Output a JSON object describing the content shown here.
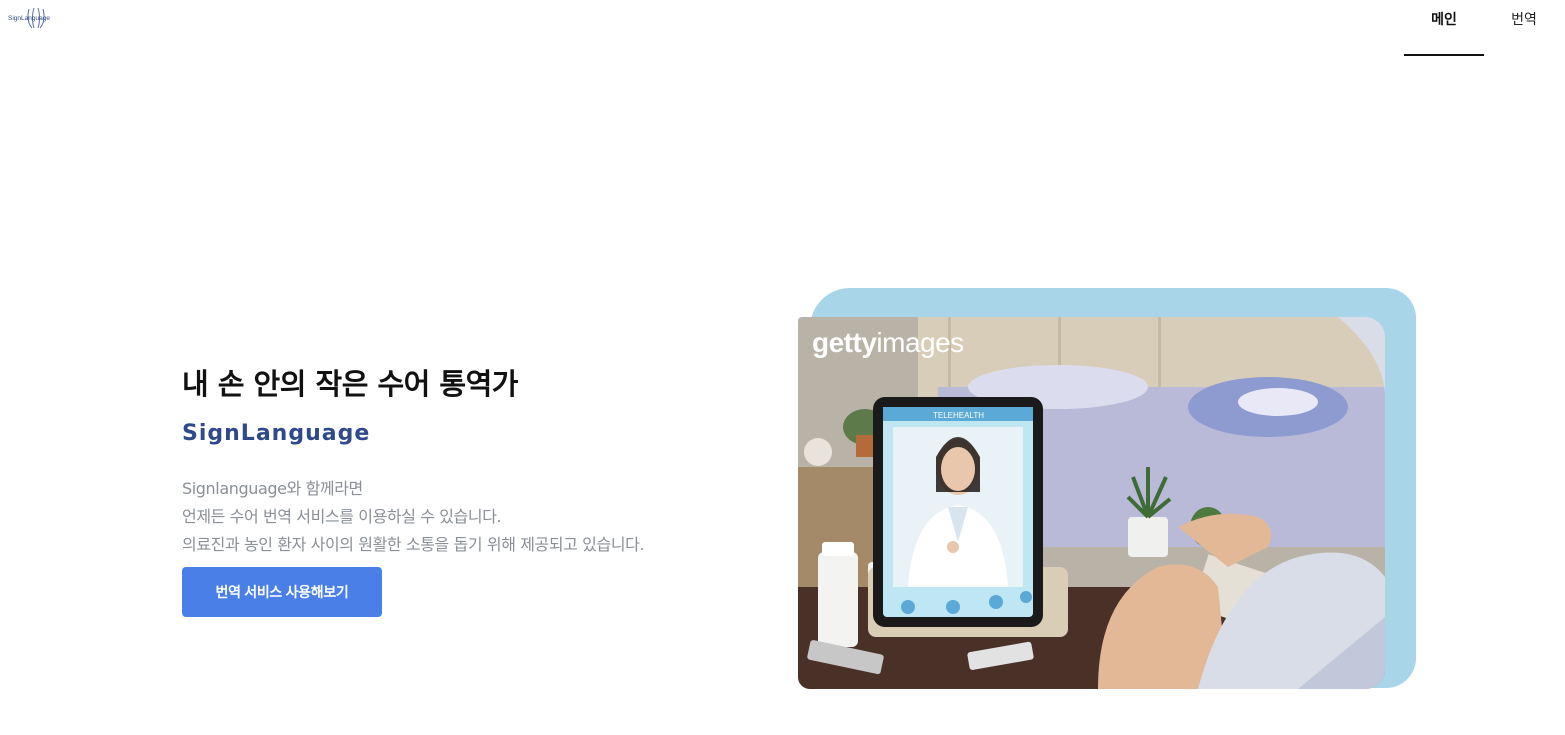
{
  "header": {
    "logo_text": "SignLanguage",
    "nav": [
      {
        "label": "메인",
        "active": true
      },
      {
        "label": "번역",
        "active": false
      }
    ]
  },
  "hero": {
    "title": "내 손 안의 작은 수어 통역가",
    "brand": "SignLanguage",
    "description": [
      "Signlanguage와 함께라면",
      "언제든 수어 번역 서비스를 이용하실 수 있습니다.",
      "의료진과 농인 환자 사이의 원활한 소통을 돕기 위해 제공되고 있습니다."
    ],
    "cta_label": "번역 서비스 사용해보기"
  },
  "image": {
    "watermark_bold": "getty",
    "watermark_light": "images",
    "tablet_header": "TELEHEALTH"
  },
  "colors": {
    "accent": "#4a7fe8",
    "brand": "#2f4a8a",
    "frame": "#a8d6e8",
    "text_muted": "#8a8f98"
  }
}
